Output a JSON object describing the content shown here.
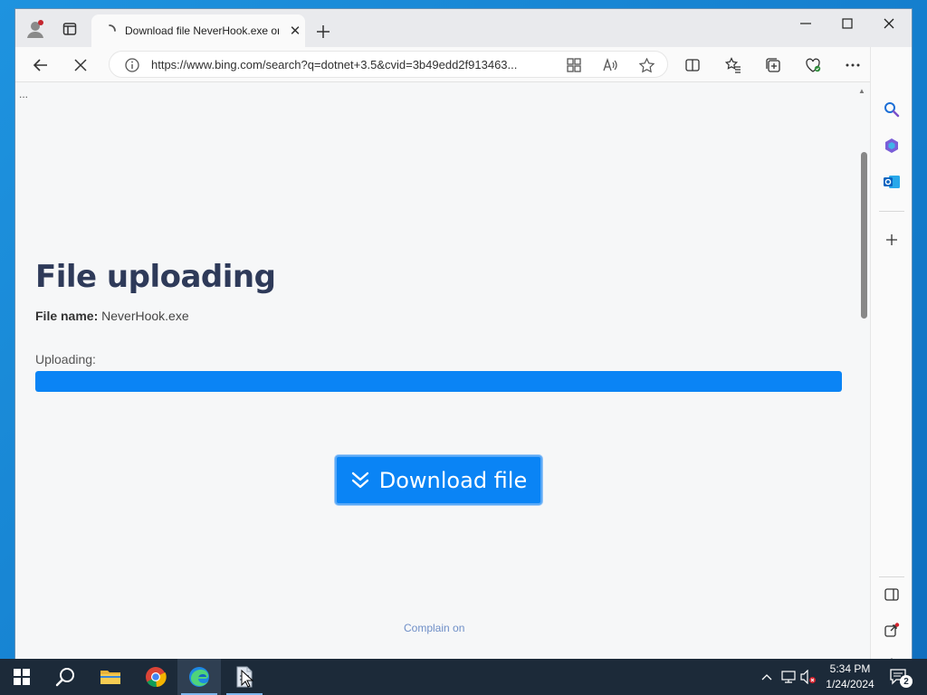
{
  "browser": {
    "tab": {
      "title": "Download file NeverHook.exe on",
      "close_glyph": "✕",
      "loading": true
    },
    "address": {
      "url": "https://www.bing.com/search?q=dotnet+3.5&cvid=3b49edd2f913463..."
    },
    "window_controls": [
      "minimize",
      "maximize",
      "close"
    ]
  },
  "page": {
    "ellipsis": "...",
    "heading": "File uploading",
    "file_name_label": "File name:",
    "file_name_value": "NeverHook.exe",
    "uploading_label": "Uploading:",
    "progress_percent": 100,
    "download_button_label": "Download file",
    "complain_link": "Complain on"
  },
  "sidebar": {
    "items": [
      "search-icon",
      "copilot-icon",
      "outlook-icon",
      "add-icon"
    ],
    "bottom_items": [
      "split-view-icon",
      "open-external-icon",
      "settings-icon"
    ]
  },
  "taskbar": {
    "apps": [
      "start-icon",
      "search-icon",
      "file-explorer-icon",
      "chrome-icon",
      "edge-icon",
      "file-icon"
    ],
    "clock": {
      "time": "5:34 PM",
      "date": "1/24/2024"
    },
    "notification_count": "2"
  },
  "colors": {
    "accent": "#0a84f5",
    "heading": "#2e3a59",
    "taskbar": "#1c2a39",
    "desktop": "#1a8fd8"
  }
}
